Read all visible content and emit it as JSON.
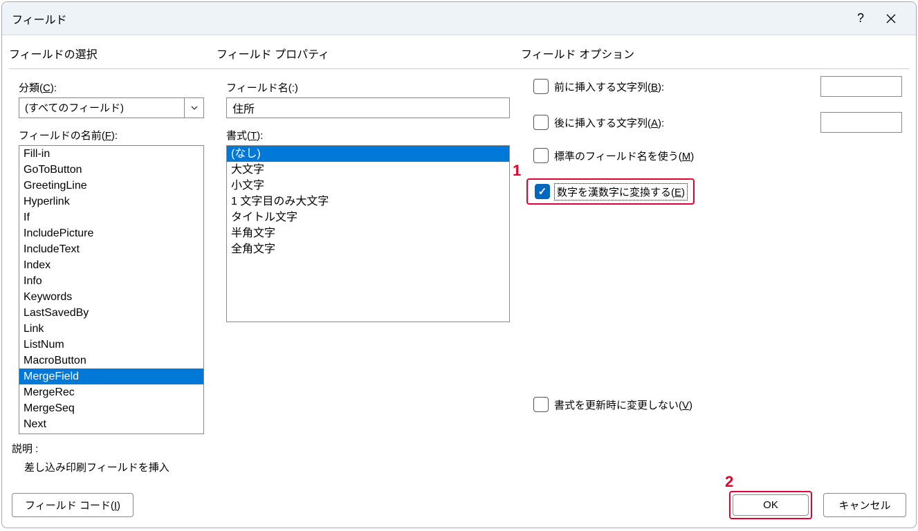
{
  "dialog": {
    "title": "フィールド"
  },
  "left": {
    "head": "フィールドの選択",
    "category_label_pre": "分類(",
    "category_key": "C",
    "category_label_post": "):",
    "category_value": "(すべてのフィールド)",
    "fieldname_label_pre": "フィールドの名前(",
    "fieldname_key": "F",
    "fieldname_label_post": "):",
    "fields": [
      "Fill-in",
      "GoToButton",
      "GreetingLine",
      "Hyperlink",
      "If",
      "IncludePicture",
      "IncludeText",
      "Index",
      "Info",
      "Keywords",
      "LastSavedBy",
      "Link",
      "ListNum",
      "MacroButton",
      "MergeField",
      "MergeRec",
      "MergeSeq",
      "Next"
    ],
    "selected_field_index": 14
  },
  "mid": {
    "head": "フィールド プロパティ",
    "fieldname_label": "フィールド名(:)",
    "fieldname_value": "住所",
    "format_label_pre": "書式(",
    "format_key": "T",
    "format_label_post": "):",
    "formats": [
      "(なし)",
      "大文字",
      "小文字",
      "1 文字目のみ大文字",
      "タイトル文字",
      "半角文字",
      "全角文字"
    ],
    "selected_format_index": 0
  },
  "right": {
    "head": "フィールド オプション",
    "opt1_pre": "前に挿入する文字列(",
    "opt1_key": "B",
    "opt1_post": "):",
    "opt2_pre": "後に挿入する文字列(",
    "opt2_key": "A",
    "opt2_post": "):",
    "opt3_pre": "標準のフィールド名を使う(",
    "opt3_key": "M",
    "opt3_post": ")",
    "opt4_pre": "数字を漢数字に変換する(",
    "opt4_key": "E",
    "opt4_post": ")",
    "opt5_pre": "書式を更新時に変更しない(",
    "opt5_key": "V",
    "opt5_post": ")"
  },
  "footer": {
    "desc_label": "説明 :",
    "desc_text": "差し込み印刷フィールドを挿入",
    "fieldcode_pre": "フィールド コード(",
    "fieldcode_key": "I",
    "fieldcode_post": ")",
    "ok": "OK",
    "cancel": "キャンセル"
  },
  "annotations": {
    "a1": "1",
    "a2": "2"
  }
}
